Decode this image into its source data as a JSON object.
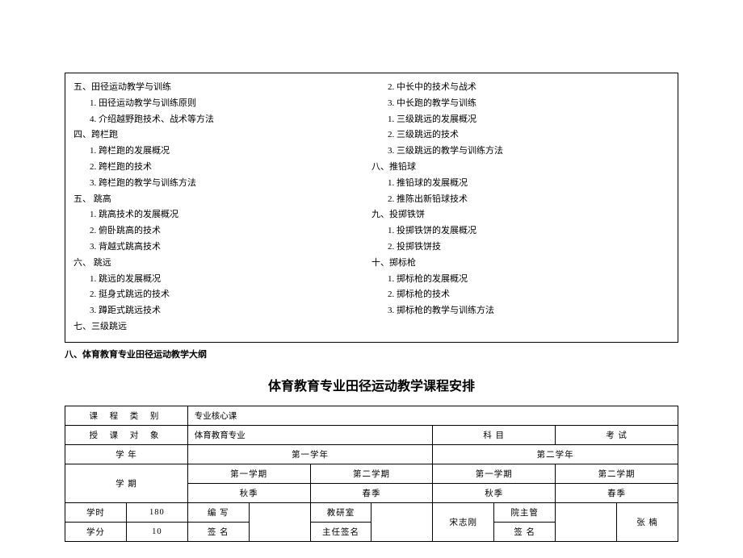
{
  "outline": {
    "left": [
      {
        "lvl": 0,
        "text": "五、田径运动教学与训练"
      },
      {
        "lvl": 1,
        "text": "1.  田径运动教学与训练原则"
      },
      {
        "lvl": 1,
        "text": "4.  介绍越野跑技术、战术等方法"
      },
      {
        "lvl": 0,
        "text": "四、跨栏跑"
      },
      {
        "lvl": 1,
        "text": "1.  跨栏跑的发展概况"
      },
      {
        "lvl": 1,
        "text": "2.  跨栏跑的技术"
      },
      {
        "lvl": 1,
        "text": "3.  跨栏跑的教学与训练方法"
      },
      {
        "lvl": 0,
        "text": "五、 跳高"
      },
      {
        "lvl": 1,
        "text": "1.  跳高技术的发展概况"
      },
      {
        "lvl": 1,
        "text": "2.  俯卧跳高的技术"
      },
      {
        "lvl": 1,
        "text": "3.  背越式跳高技术"
      },
      {
        "lvl": 0,
        "text": "六、 跳远"
      },
      {
        "lvl": 1,
        "text": "1.  跳远的发展概况"
      },
      {
        "lvl": 1,
        "text": "2.  挺身式跳远的技术"
      },
      {
        "lvl": 1,
        "text": "3.  蹲距式跳远技术"
      },
      {
        "lvl": 0,
        "text": "七、三级跳远"
      }
    ],
    "right": [
      {
        "lvl": 1,
        "text": "2.  中长中的技术与战术"
      },
      {
        "lvl": 1,
        "text": "3.  中长跑的教学与训练"
      },
      {
        "lvl": 1,
        "text": "1.  三级跳远的发展概况"
      },
      {
        "lvl": 1,
        "text": "2.  三级跳远的技术"
      },
      {
        "lvl": 1,
        "text": "3.  三级跳远的教学与训练方法"
      },
      {
        "lvl": 0,
        "text": "八、推铅球"
      },
      {
        "lvl": 1,
        "text": "1.  推铅球的发展概况"
      },
      {
        "lvl": 1,
        "text": "2.  推陈出新铅球技术"
      },
      {
        "lvl": 0,
        "text": "九、投掷铁饼"
      },
      {
        "lvl": 1,
        "text": "1.  投掷铁饼的发展概况"
      },
      {
        "lvl": 1,
        "text": "2.  投掷铁饼技"
      },
      {
        "lvl": 0,
        "text": "十、掷标枪"
      },
      {
        "lvl": 1,
        "text": "1.  掷标枪的发展概况"
      },
      {
        "lvl": 1,
        "text": "2.  掷标枪的技术"
      },
      {
        "lvl": 1,
        "text": "3.  掷标枪的教学与训练方法"
      }
    ]
  },
  "section_label": "八、体育教育专业田径运动教学大纲",
  "title": "体育教育专业田径运动教学课程安排",
  "schedule": {
    "row1": {
      "c1": "课 程 类 别",
      "c2": "专业核心课"
    },
    "row2": {
      "c1": "授 课 对 象",
      "c2": "体育教育专业",
      "c3": "科    目",
      "c4": "考   试"
    },
    "row3": {
      "c1": "学        年",
      "c2": "第一学年",
      "c3": "第二学年"
    },
    "row4": {
      "c1": "学        期",
      "c2": "第一学期",
      "c3": "第二学期",
      "c4": "第一学期",
      "c5": "第二学期"
    },
    "row5": {
      "c1": "秋季",
      "c2": "春季",
      "c3": "秋季",
      "c4": "春季"
    },
    "row6": {
      "c1": "学时",
      "c2": "180",
      "c3": "编   写",
      "c5": "教研室",
      "c7": "宋志刚",
      "c8": "院主管",
      "c10": "张   楠"
    },
    "row7": {
      "c1": "学分",
      "c2": "10",
      "c3": "签   名",
      "c5": "主任签名",
      "c8": "签   名"
    }
  }
}
